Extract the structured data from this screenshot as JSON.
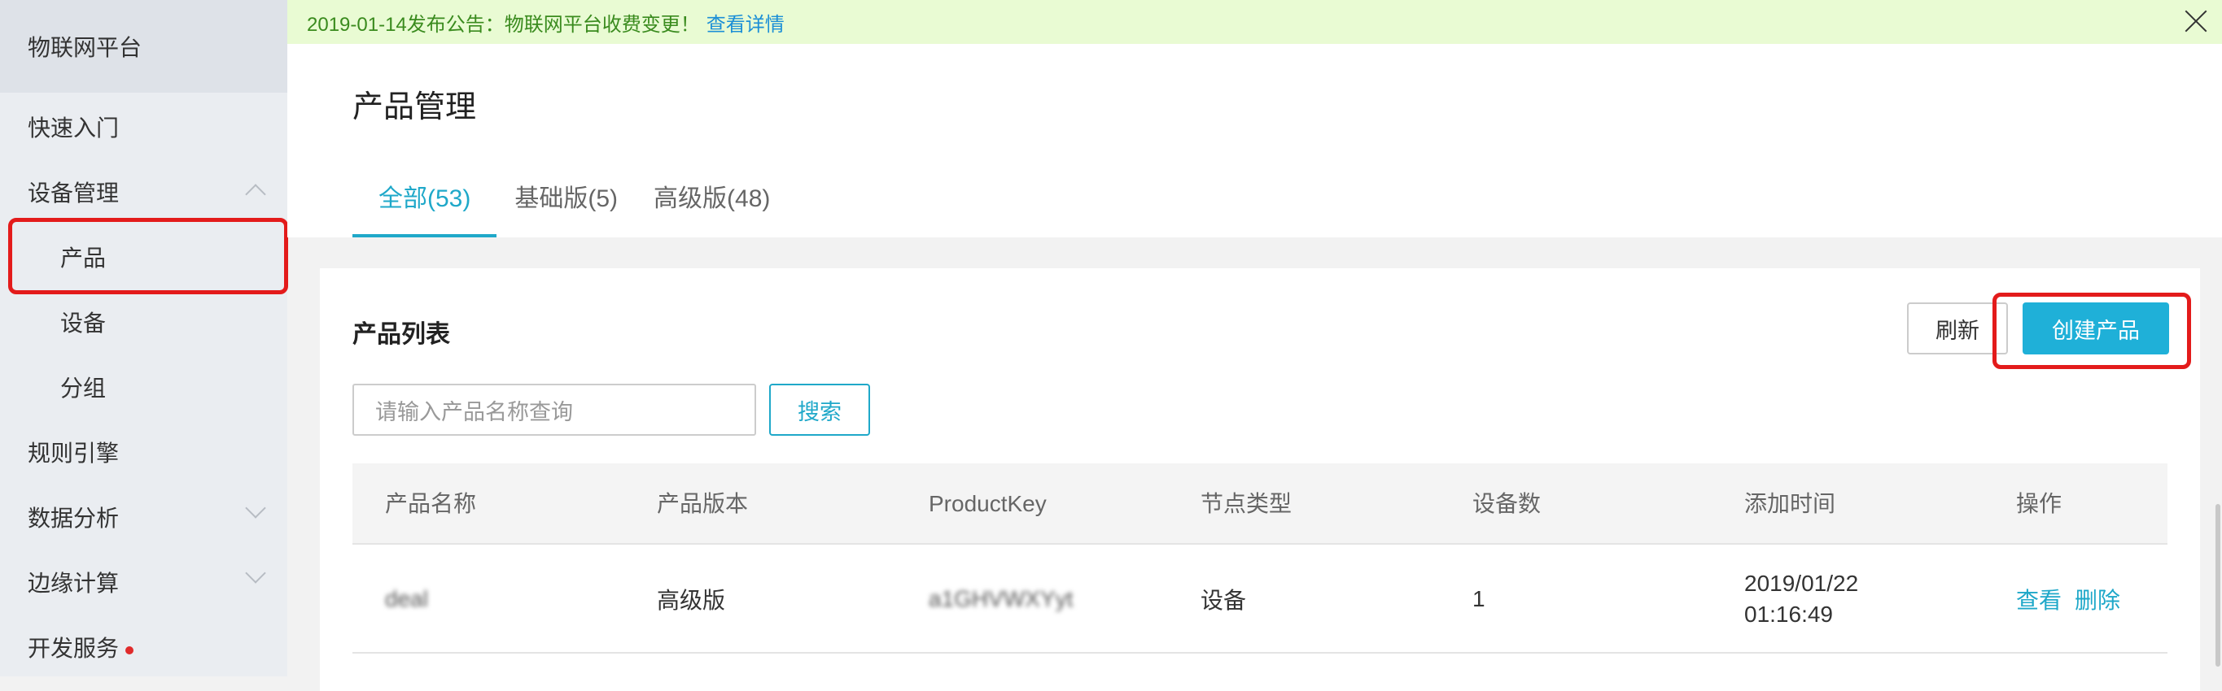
{
  "sidebar": {
    "platform_title": "物联网平台",
    "items": [
      {
        "label": "快速入门"
      },
      {
        "label": "设备管理"
      },
      {
        "label": "产品"
      },
      {
        "label": "设备"
      },
      {
        "label": "分组"
      },
      {
        "label": "规则引擎"
      },
      {
        "label": "数据分析"
      },
      {
        "label": "边缘计算"
      },
      {
        "label": "开发服务"
      }
    ]
  },
  "notice": {
    "text": "2019-01-14发布公告：物联网平台收费变更！",
    "link": "查看详情"
  },
  "header": {
    "title": "产品管理",
    "tabs": [
      {
        "label": "全部(53)",
        "active": true
      },
      {
        "label": "基础版(5)",
        "active": false
      },
      {
        "label": "高级版(48)",
        "active": false
      }
    ]
  },
  "list": {
    "title": "产品列表",
    "refresh_label": "刷新",
    "create_label": "创建产品",
    "search_placeholder": "请输入产品名称查询",
    "search_label": "搜索",
    "columns": [
      "产品名称",
      "产品版本",
      "ProductKey",
      "节点类型",
      "设备数",
      "添加时间",
      "操作"
    ],
    "rows": [
      {
        "name": "deal",
        "version": "高级版",
        "product_key": "a1GHVWXYyt",
        "node_type": "设备",
        "device_count": "1",
        "date": "2019/01/22",
        "time": "01:16:49",
        "view": "查看",
        "delete": "删除"
      }
    ]
  },
  "colors": {
    "accent": "#1fb0d8",
    "highlight": "#e31b1b",
    "notice_bg": "#e9fbd3"
  }
}
